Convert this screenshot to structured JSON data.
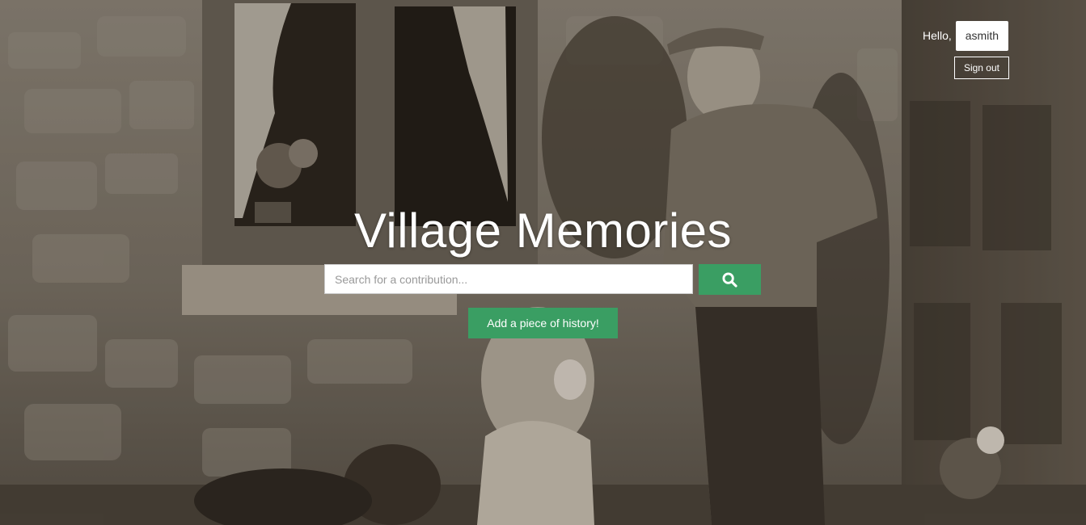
{
  "header": {
    "greeting": "Hello,",
    "username": "asmith",
    "signout_label": "Sign out"
  },
  "hero": {
    "title": "Village Memories",
    "search": {
      "placeholder": "Search for a contribution...",
      "value": "",
      "icon": "search-icon"
    },
    "add_button_label": "Add a piece of history!"
  },
  "colors": {
    "accent": "#3a9e63",
    "text": "#ffffff"
  }
}
